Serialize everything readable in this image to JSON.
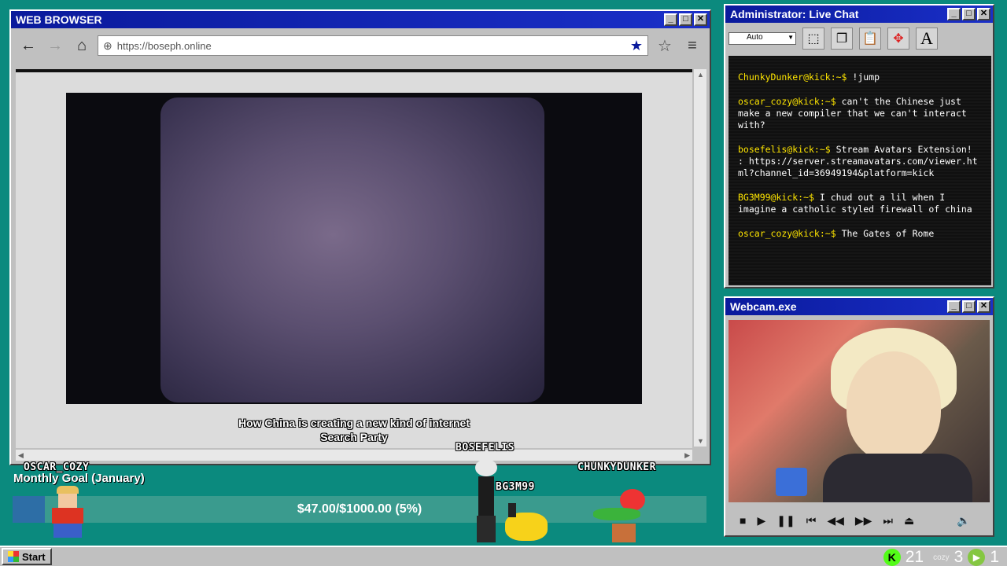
{
  "browser": {
    "title": "WEB BROWSER",
    "url": "https://boseph.online",
    "caption_line1": "How China is creating a new kind of internet",
    "caption_line2": "Search Party"
  },
  "chat": {
    "title": "Administrator: Live Chat",
    "font_select": "Auto",
    "messages": [
      {
        "user": "ChunkyDunker@kick:~$",
        "text": "!jump"
      },
      {
        "user": "oscar_cozy@kick:~$",
        "text": "can't the Chinese just make a new compiler that we can't interact with?"
      },
      {
        "user": "bosefelis@kick:~$",
        "text": "Stream Avatars Extension! : https://server.streamavatars.com/viewer.html?channel_id=36949194&platform=kick"
      },
      {
        "user": "BG3M99@kick:~$",
        "text": "I chud out a lil when I imagine a catholic styled firewall of china"
      },
      {
        "user": "oscar_cozy@kick:~$",
        "text": "The Gates of Rome"
      }
    ]
  },
  "webcam": {
    "title": "Webcam.exe"
  },
  "goal": {
    "label": "Monthly Goal (January)",
    "text": "$47.00/$1000.00 (5%)",
    "fraction": 0.047
  },
  "avatars": [
    {
      "name": "OSCAR_COZY"
    },
    {
      "name": "BOSEFELIS"
    },
    {
      "name": "BG3M99"
    },
    {
      "name": "CHUNKYDUNKER"
    }
  ],
  "taskbar": {
    "start_label": "Start",
    "kick_count": "21",
    "cozy_count": "3",
    "rumble_count": "1"
  },
  "colors": {
    "desktop": "#0b8a7e",
    "titlebar": "#0a1a9c",
    "chat_username": "#ffe600",
    "goal_fill": "#2d6ea6"
  }
}
